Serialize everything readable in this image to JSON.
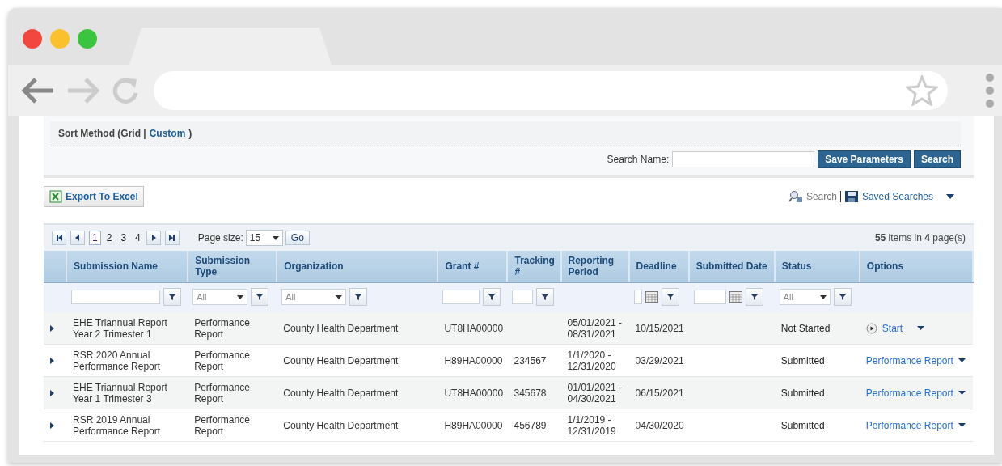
{
  "sort_method": {
    "label": "Sort Method (Grid |",
    "link": "Custom",
    "close": ")"
  },
  "search_name": {
    "label": "Search Name:"
  },
  "buttons": [
    "Save Parameters",
    "Search"
  ],
  "export": "Export To Excel",
  "search_links": {
    "search": "Search",
    "saved": "Saved Searches"
  },
  "pager": {
    "pages": [
      {
        "label": "1",
        "selected": true
      },
      {
        "label": "2",
        "selected": false
      },
      {
        "label": "3",
        "selected": false
      },
      {
        "label": "4",
        "selected": false
      }
    ],
    "page_size_label": "Page size:",
    "page_size": "15",
    "go": "Go",
    "summary": "**55** items in **4** page(s)"
  },
  "table": {
    "columns": [
      {
        "label": "Submission Name",
        "kind": "text"
      },
      {
        "label": "Submission Type",
        "kind": "select",
        "filter_value": "All"
      },
      {
        "label": "Organization",
        "kind": "select",
        "filter_value": "All"
      },
      {
        "label": "Grant #",
        "kind": "text"
      },
      {
        "label": "Tracking #",
        "kind": "text"
      },
      {
        "label": "Reporting Period",
        "kind": "none"
      },
      {
        "label": "Deadline",
        "kind": "date"
      },
      {
        "label": "Submitted Date",
        "kind": "date"
      },
      {
        "label": "Status",
        "kind": "select",
        "filter_value": "All"
      },
      {
        "label": "Options",
        "kind": "none"
      }
    ],
    "rows": [
      {
        "cells": [
          "EHE Triannual Report Year 2 Trimester 1",
          "Performance Report",
          "County Health Department",
          "UT8HA00000",
          "",
          "05/01/2021 - 08/31/2021",
          "10/15/2021",
          "",
          "Not Started"
        ],
        "option": {
          "kind": "start",
          "label": "Start"
        }
      },
      {
        "cells": [
          "RSR 2020 Annual Performance Report",
          "Performance Report",
          "County Health Department",
          "H89HA00000",
          "234567",
          "1/1/2020 - 12/31/2020",
          "03/29/2021",
          "",
          "Submitted"
        ],
        "option": {
          "kind": "link",
          "label": "Performance Report"
        }
      },
      {
        "cells": [
          "EHE Triannual Report Year 1 Trimester 3",
          "Performance Report",
          "County Health Department",
          "UT8HA00000",
          "345678",
          "01/01/2021 - 04/30/2021",
          "06/15/2021",
          "",
          "Submitted"
        ],
        "option": {
          "kind": "link",
          "label": "Performance Report"
        }
      },
      {
        "cells": [
          "RSR 2019 Annual Performance Report",
          "Performance Report",
          "County Health Department",
          "H89HA00000",
          "456789",
          "1/1/2019 - 12/31/2019",
          "04/30/2020",
          "",
          "Submitted"
        ],
        "option": {
          "kind": "link",
          "label": "Performance Report"
        }
      }
    ]
  }
}
